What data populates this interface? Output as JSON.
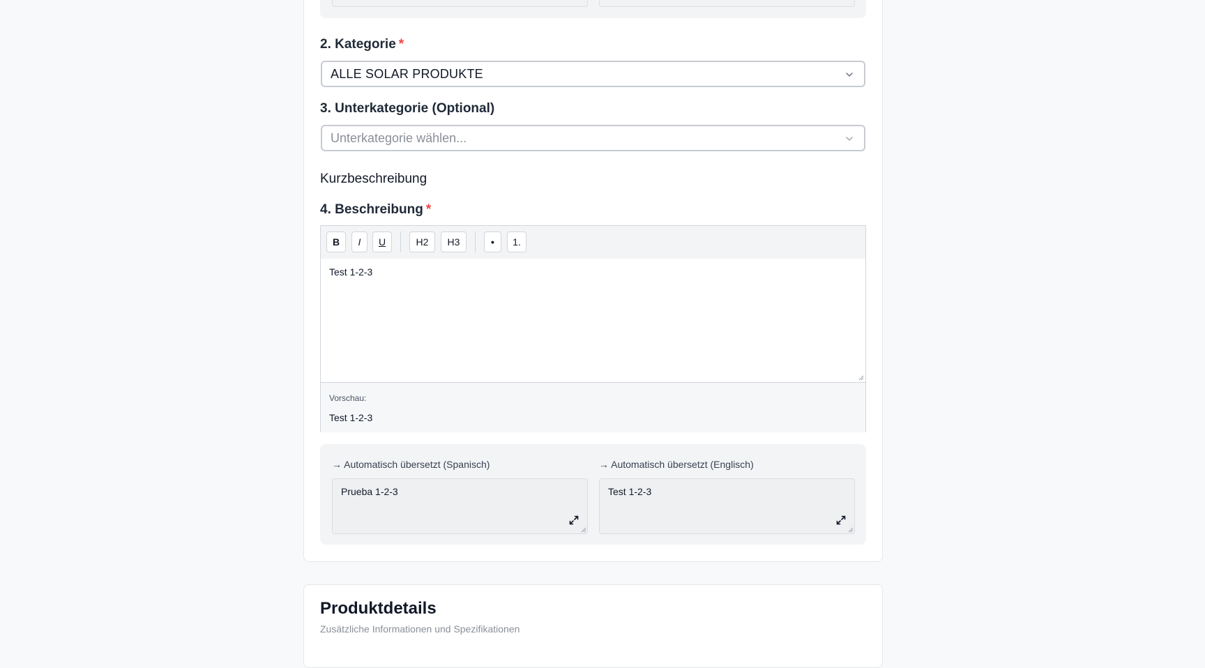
{
  "category": {
    "label": "2. Kategorie",
    "required_mark": "*",
    "selected": "ALLE SOLAR PRODUKTE"
  },
  "subcategory": {
    "label": "3. Unterkategorie (Optional)",
    "placeholder": "Unterkategorie wählen..."
  },
  "short_description": {
    "label": "Kurzbeschreibung"
  },
  "description": {
    "label": "4. Beschreibung",
    "required_mark": "*",
    "toolbar": {
      "bold": "B",
      "italic": "I",
      "underline": "U",
      "h2": "H2",
      "h3": "H3",
      "bullet": "•",
      "numbered": "1."
    },
    "content": "Test 1-2-3",
    "preview_label": "Vorschau:",
    "preview_text": "Test 1-2-3"
  },
  "translations": [
    {
      "label": "→ Automatisch übersetzt (Spanisch)",
      "text": "Prueba 1-2-3"
    },
    {
      "label": "→ Automatisch übersetzt (Englisch)",
      "text": "Test 1-2-3"
    }
  ],
  "product_details": {
    "title": "Produktdetails",
    "subtitle": "Zusätzliche Informationen und Spezifikationen"
  },
  "colors": {
    "required": "#ef4444",
    "page_bg": "#f8f9fb",
    "panel_bg": "#f3f4f6"
  }
}
